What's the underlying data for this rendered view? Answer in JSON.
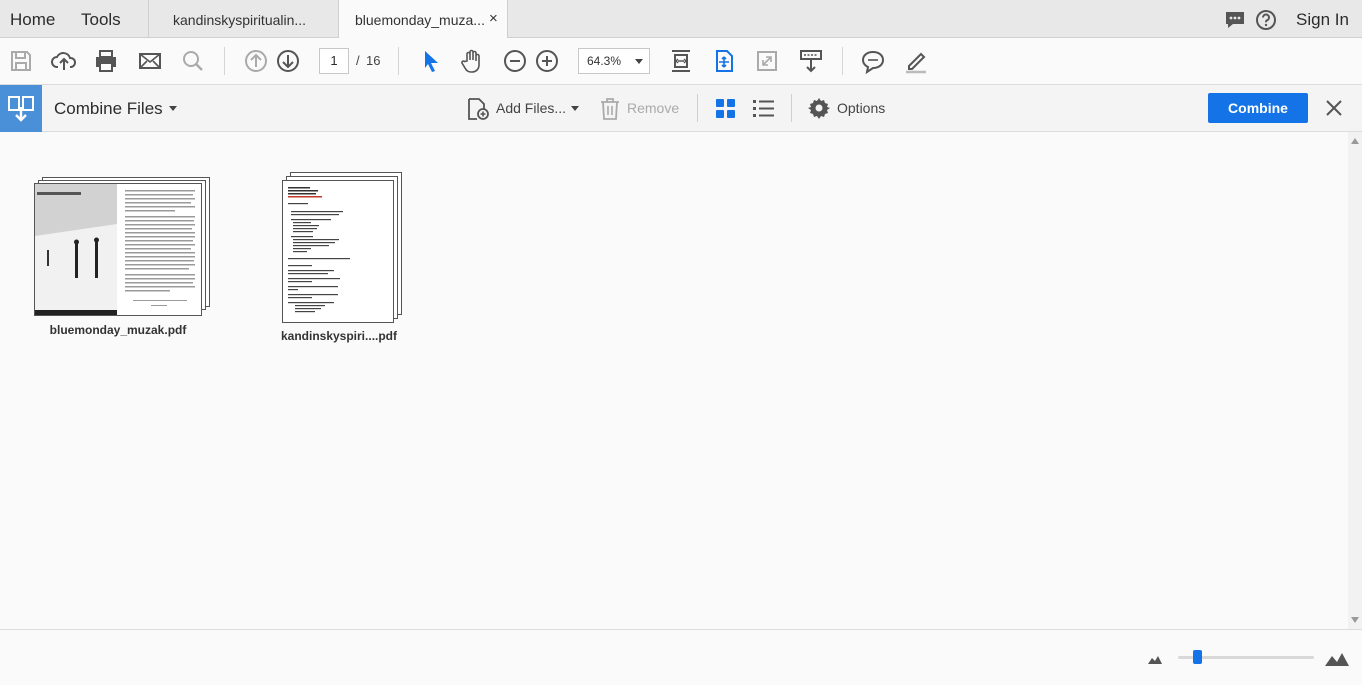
{
  "menubar": {
    "home": "Home",
    "tools": "Tools",
    "tabs": [
      {
        "label": "kandinskyspiritualin..."
      },
      {
        "label": "bluemonday_muza...",
        "close": "×"
      }
    ],
    "sign_in": "Sign In",
    "icons": [
      "chat-icon",
      "help-icon"
    ]
  },
  "toolbar": {
    "page_current": "1",
    "page_sep": "/",
    "page_total": "16",
    "zoom": "64.3%"
  },
  "combine": {
    "title": "Combine Files",
    "add_files": "Add Files...",
    "remove": "Remove",
    "options": "Options",
    "combine_button": "Combine",
    "accent": "#1473e6"
  },
  "files": [
    {
      "name": "bluemonday_muzak.pdf"
    },
    {
      "name": "kandinskyspiri....pdf"
    }
  ],
  "footer": {
    "zoom_slider_fraction": 0.12
  }
}
